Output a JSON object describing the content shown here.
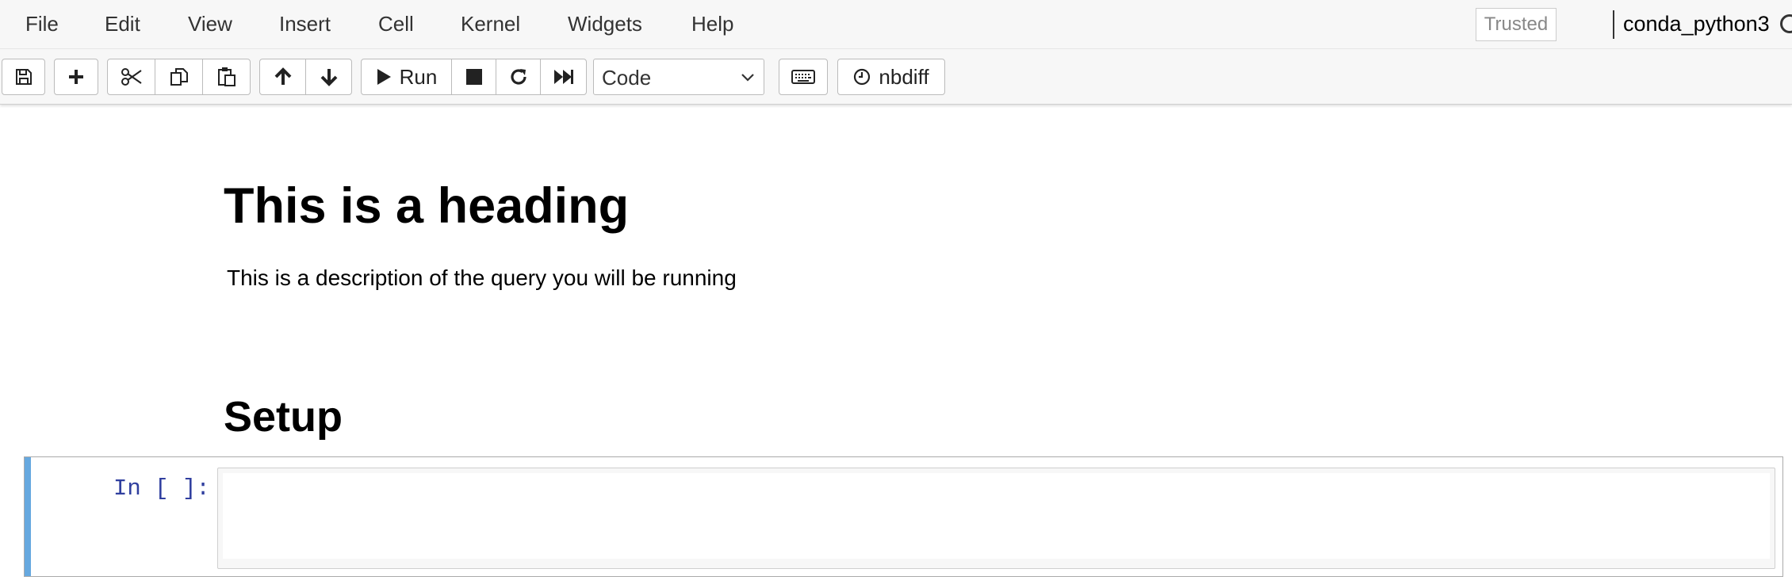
{
  "menu": {
    "items": [
      {
        "label": "File"
      },
      {
        "label": "Edit"
      },
      {
        "label": "View"
      },
      {
        "label": "Insert"
      },
      {
        "label": "Cell"
      },
      {
        "label": "Kernel"
      },
      {
        "label": "Widgets"
      },
      {
        "label": "Help"
      }
    ],
    "trusted": "Trusted",
    "kernel_name": "conda_python3"
  },
  "toolbar": {
    "icons": {
      "save": "floppy-disk-icon",
      "insert": "plus-icon",
      "cut": "scissors-icon",
      "copy": "copy-icon",
      "paste": "paste-icon",
      "move_up": "arrow-up-icon",
      "move_down": "arrow-down-icon",
      "run": "play-icon",
      "interrupt": "stop-icon",
      "restart": "refresh-icon",
      "restart_run_all": "fast-forward-icon",
      "keyboard": "keyboard-icon",
      "nbdiff": "clock-icon"
    },
    "run_label": "Run",
    "cell_type": "Code",
    "nbdiff_label": "nbdiff"
  },
  "notebook": {
    "heading": "This is a heading",
    "description": "This is a description of the query you will be running",
    "section_heading": "Setup",
    "code_cell": {
      "prompt": "In [ ]:",
      "source": ""
    }
  },
  "colors": {
    "selected_cell_bar": "#66a8df",
    "prompt": "#303f9f",
    "menubar_bg": "#f7f7f7"
  }
}
